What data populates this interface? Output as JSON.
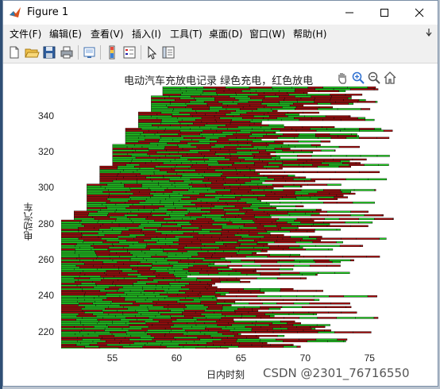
{
  "window": {
    "title": "Figure 1",
    "controls": {
      "minimize": "—",
      "maximize": "☐",
      "close": "✕"
    }
  },
  "menu": {
    "items": [
      "文件(F)",
      "编辑(E)",
      "查看(V)",
      "插入(I)",
      "工具(T)",
      "桌面(D)",
      "窗口(W)",
      "帮助(H)"
    ]
  },
  "toolbar": {
    "buttons": [
      "new-figure-icon",
      "open-file-icon",
      "save-icon",
      "print-icon",
      "link-plot-icon",
      "insert-colorbar-icon",
      "insert-legend-icon",
      "edit-plot-arrow-icon",
      "property-inspector-icon"
    ]
  },
  "axes_toolbar": {
    "buttons": [
      "pan-hand-icon",
      "zoom-in-icon",
      "zoom-out-icon",
      "home-icon"
    ]
  },
  "colors": {
    "charge": "#1fd01f",
    "discharge": "#a80a0a",
    "edge": "#000000"
  },
  "watermark": "CSDN @2301_76716550",
  "chart_data": {
    "type": "bar",
    "title": "电动汽车充放电记录  绿色充电，红色放电",
    "xlabel": "日内时刻",
    "ylabel": "电动汽车",
    "xlim": [
      51,
      77
    ],
    "ylim": [
      211,
      357
    ],
    "xticks": [
      55,
      60,
      65,
      70,
      75
    ],
    "yticks": [
      220,
      240,
      260,
      280,
      300,
      320,
      340
    ],
    "legend": "none",
    "grid": false,
    "series": [
      {
        "name": "绿色充电",
        "color": "#1fd01f"
      },
      {
        "name": "红色放电",
        "color": "#a80a0a"
      }
    ]
  }
}
